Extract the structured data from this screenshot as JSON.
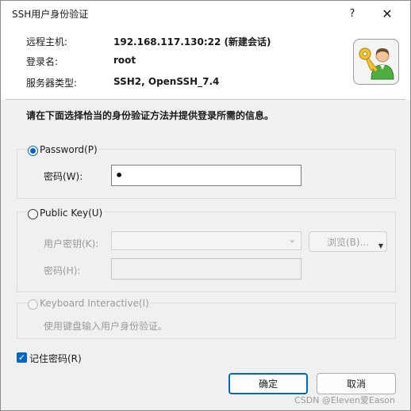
{
  "window": {
    "title": "SSH用户身份验证",
    "help_glyph": "?",
    "close_glyph": "✕"
  },
  "info": {
    "host_label": "远程主机:",
    "host_value": "192.168.117.130:22 (新建会话)",
    "user_label": "登录名:",
    "user_value": "root",
    "server_label": "服务器类型:",
    "server_value": "SSH2, OpenSSH_7.4"
  },
  "instruction": "请在下面选择恰当的身份验证方法并提供登录所需的信息。",
  "password_group": {
    "label": "Password(P)",
    "selected": true,
    "field_label": "密码(W):",
    "field_value": "•"
  },
  "pubkey_group": {
    "label": "Public Key(U)",
    "selected": false,
    "key_label": "用户密钥(K):",
    "key_value": "",
    "browse_label": "浏览(B)...",
    "pass_label": "密码(H):",
    "pass_value": ""
  },
  "keyboard_group": {
    "label": "Keyboard Interactive(I)",
    "selected": false,
    "hint": "使用键盘输入用户身份验证。"
  },
  "remember": {
    "label": "记住密码(R)",
    "checked": true
  },
  "buttons": {
    "ok": "确定",
    "cancel": "取消"
  },
  "watermark": "CSDN @Eleven爱Eason",
  "colors": {
    "accent": "#0067c0",
    "disabled_text": "#9a9a9a",
    "dialog_bg": "#f0f0f0"
  }
}
